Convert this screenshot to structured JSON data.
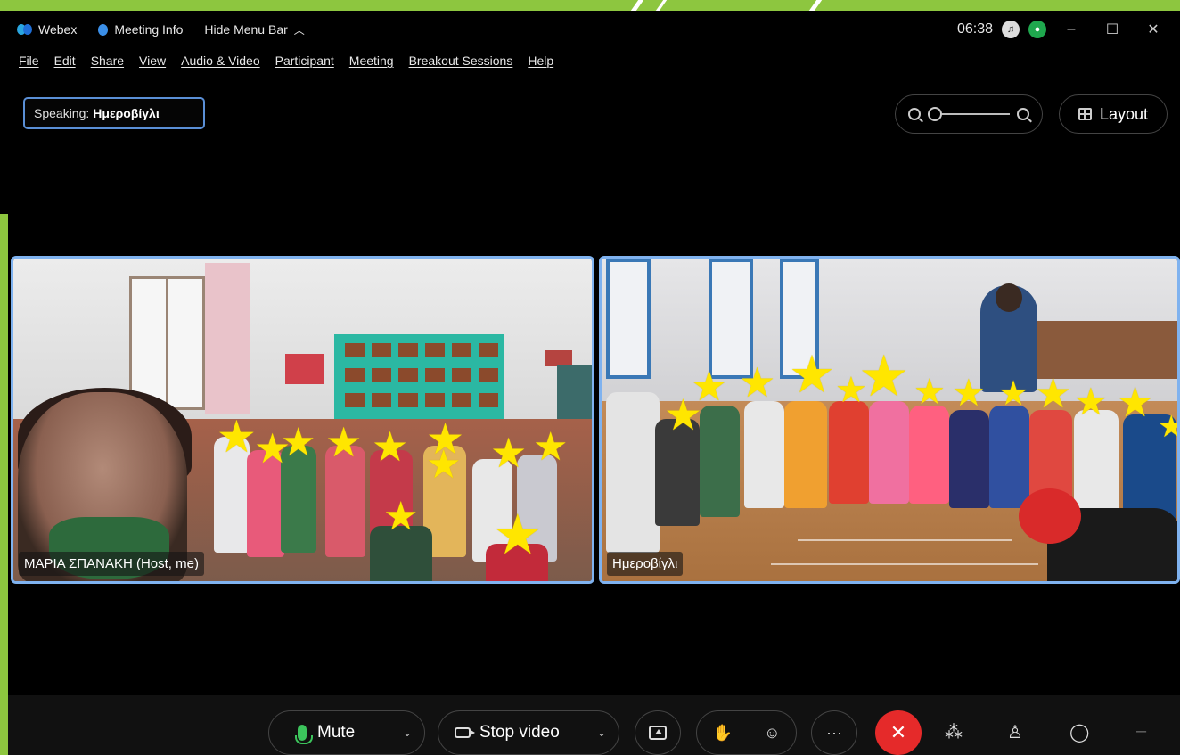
{
  "titlebar": {
    "app_name": "Webex",
    "meeting_info": "Meeting Info",
    "hide_menu_bar": "Hide Menu Bar",
    "time": "06:38"
  },
  "menu": [
    "File",
    "Edit",
    "Share",
    "View",
    "Audio & Video",
    "Participant",
    "Meeting",
    "Breakout Sessions",
    "Help"
  ],
  "speaking": {
    "label": "Speaking:",
    "name": "Ημεροβίγλι"
  },
  "layout_label": "Layout",
  "videos": [
    {
      "name": "ΜΑΡΙΑ ΣΠΑΝΑΚΗ (Host, me)"
    },
    {
      "name": "Ημεροβίγλι"
    }
  ],
  "controls": {
    "mute_label": "Mute",
    "stop_video_label": "Stop video"
  },
  "colors": {
    "frame_green": "#8dc63f",
    "tile_border": "#7fb2ef",
    "end_call_red": "#e52a2a",
    "mic_green": "#3cc45c",
    "star_yellow": "#ffe600"
  },
  "icons": [
    "webex-logo-icon",
    "meeting-info-icon",
    "chevron-up-icon",
    "headset-icon",
    "avatar-icon",
    "minimize-icon",
    "maximize-icon",
    "close-icon",
    "zoom-out-icon",
    "zoom-in-icon",
    "layout-grid-icon",
    "microphone-icon",
    "camera-icon",
    "share-icon",
    "raise-hand-icon",
    "reactions-icon",
    "more-icon",
    "end-call-icon",
    "participants-icon",
    "chat-icon"
  ]
}
